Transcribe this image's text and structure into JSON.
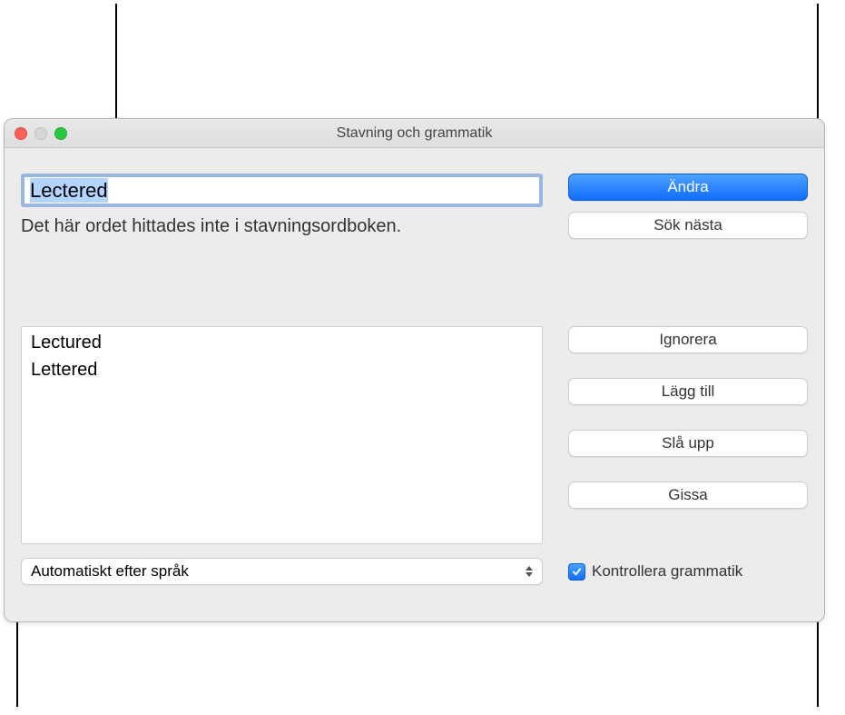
{
  "window": {
    "title": "Stavning och grammatik"
  },
  "spelling": {
    "current_word": "Lectered",
    "not_found_message": "Det här ordet hittades inte i stavningsordboken.",
    "suggestions": [
      "Lectured",
      "Lettered"
    ]
  },
  "buttons": {
    "change": "Ändra",
    "find_next": "Sök nästa",
    "ignore": "Ignorera",
    "add": "Lägg till",
    "lookup": "Slå upp",
    "guess": "Gissa"
  },
  "language_select": {
    "selected": "Automatiskt efter språk"
  },
  "grammar_checkbox": {
    "label": "Kontrollera grammatik",
    "checked": true
  }
}
